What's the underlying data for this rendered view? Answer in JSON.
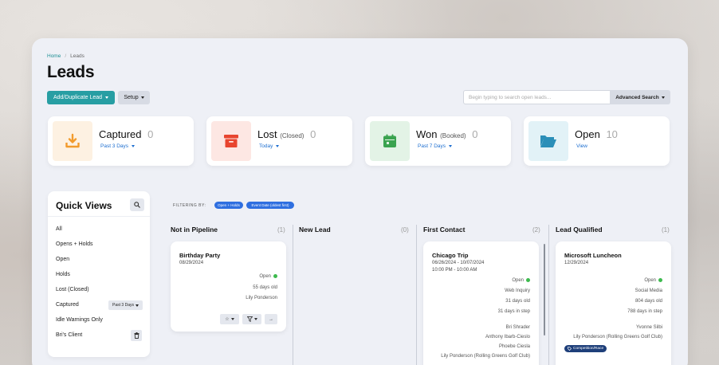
{
  "breadcrumb": {
    "home": "Home",
    "separator": "/",
    "current": "Leads"
  },
  "page_title": "Leads",
  "toolbar": {
    "add_label": "Add/Duplicate Lead",
    "setup_label": "Setup"
  },
  "search": {
    "placeholder": "Begin typing to search open leads...",
    "advanced_label": "Advanced Search"
  },
  "stats": [
    {
      "title": "Captured",
      "sub": "",
      "count": "0",
      "link": "Past 3 Days",
      "icon": "download-tray-icon",
      "color": "#f29b2c",
      "bg": "#fdf1e2"
    },
    {
      "title": "Lost",
      "sub": "(Closed)",
      "count": "0",
      "link": "Today",
      "icon": "archive-box-icon",
      "color": "#e8452f",
      "bg": "#fde7e3"
    },
    {
      "title": "Won",
      "sub": "(Booked)",
      "count": "0",
      "link": "Past 7 Days",
      "icon": "calendar-icon",
      "color": "#3aa34f",
      "bg": "#e3f3e6"
    },
    {
      "title": "Open",
      "sub": "",
      "count": "10",
      "link": "View",
      "icon": "open-folder-icon",
      "color": "#2b8fb8",
      "bg": "#e2f2f7"
    }
  ],
  "quick_views": {
    "title": "Quick Views",
    "items": [
      "All",
      "Opens + Holds",
      "Open",
      "Holds",
      "Lost (Closed)",
      "Captured",
      "Idle Warnings Only",
      "Bri's Client"
    ],
    "captured_filter": "Past 3 Days"
  },
  "filter": {
    "label": "FILTERING BY:",
    "chips": [
      "Open + Holds",
      "Event Date (oldest first)"
    ]
  },
  "columns": [
    {
      "title": "Not in Pipeline",
      "count": "(1)"
    },
    {
      "title": "New Lead",
      "count": "(0)"
    },
    {
      "title": "First Contact",
      "count": "(2)"
    },
    {
      "title": "Lead Qualified",
      "count": "(1)"
    }
  ],
  "cards": {
    "birthday": {
      "title": "Birthday Party",
      "date": "08/29/2024",
      "status": "Open",
      "age": "55 days old",
      "owner": "Lily Ponderson"
    },
    "chicago": {
      "title": "Chicago Trip",
      "dates": "06/26/2024 - 10/07/2024",
      "time": "10:00 PM - 10:00 AM",
      "status": "Open",
      "source": "Web Inquiry",
      "age": "31 days old",
      "step": "31 days in step",
      "people": [
        "Bri Shrader",
        "Anthony Ibarb-Cieslo",
        "Phoebe Ciesla",
        "Lily Ponderson (Rolling Greens Golf Club)"
      ]
    },
    "microsoft": {
      "title": "Microsoft Luncheon",
      "date": "12/29/2024",
      "status": "Open",
      "source": "Social Media",
      "age": "804 days old",
      "step": "788 days in step",
      "people": [
        "Yvonne Silbi",
        "Lily Ponderson (Rolling Greens Golf Club)"
      ],
      "tag": "Competition/Race"
    }
  },
  "colors": {
    "accent": "#279ea3",
    "link": "#1e6fd0",
    "chip": "#2f6fe0",
    "open_dot": "#3dba4e"
  }
}
